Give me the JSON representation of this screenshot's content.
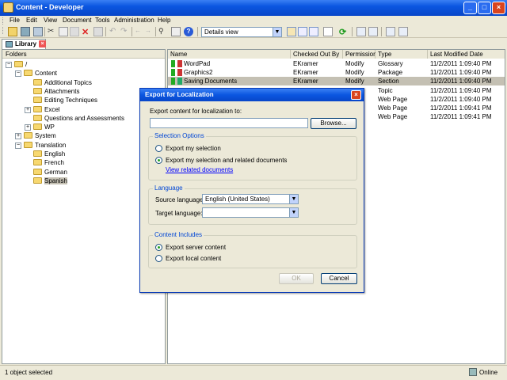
{
  "window": {
    "title": "Content - Developer"
  },
  "menu": [
    "File",
    "Edit",
    "View",
    "Document",
    "Tools",
    "Administration",
    "Help"
  ],
  "toolbar": {
    "view_selector": "Details view"
  },
  "tabs": {
    "library": "Library"
  },
  "folders": {
    "header": "Folders",
    "items": [
      {
        "label": "/",
        "depth": 0
      },
      {
        "label": "Content",
        "depth": 1
      },
      {
        "label": "Additional Topics",
        "depth": 2
      },
      {
        "label": "Attachments",
        "depth": 2
      },
      {
        "label": "Editing Techniques",
        "depth": 2
      },
      {
        "label": "Excel",
        "depth": 2
      },
      {
        "label": "Questions and Assessments",
        "depth": 2
      },
      {
        "label": "WP",
        "depth": 2
      },
      {
        "label": "System",
        "depth": 1
      },
      {
        "label": "Translation",
        "depth": 1
      },
      {
        "label": "English",
        "depth": 2
      },
      {
        "label": "French",
        "depth": 2
      },
      {
        "label": "German",
        "depth": 2
      },
      {
        "label": "Spanish",
        "depth": 2,
        "selected": true
      }
    ]
  },
  "table": {
    "columns": [
      "Name",
      "Checked Out By",
      "Permission",
      "Type",
      "Last Modified Date"
    ],
    "rows": [
      {
        "name": "WordPad",
        "checked_out_by": "EKramer",
        "permission": "Modify",
        "type": "Glossary",
        "modified": "11/2/2011 1:09:40 PM"
      },
      {
        "name": "Graphics2",
        "checked_out_by": "EKramer",
        "permission": "Modify",
        "type": "Package",
        "modified": "11/2/2011 1:09:40 PM"
      },
      {
        "name": "Saving Documents",
        "checked_out_by": "EKramer",
        "permission": "Modify",
        "type": "Section",
        "modified": "11/2/2011 1:09:40 PM",
        "selected": true
      },
      {
        "name": "",
        "checked_out_by": "",
        "permission": "",
        "type": "Topic",
        "modified": "11/2/2011 1:09:40 PM"
      },
      {
        "name": "",
        "checked_out_by": "",
        "permission": "",
        "type": "Web Page",
        "modified": "11/2/2011 1:09:40 PM"
      },
      {
        "name": "",
        "checked_out_by": "",
        "permission": "",
        "type": "Web Page",
        "modified": "11/2/2011 1:09:41 PM"
      },
      {
        "name": "",
        "checked_out_by": "",
        "permission": "",
        "type": "Web Page",
        "modified": "11/2/2011 1:09:41 PM"
      }
    ]
  },
  "status": {
    "left": "1 object selected",
    "right": "Online"
  },
  "dialog": {
    "title": "Export for Localization",
    "export_to_label": "Export content for localization to:",
    "export_to_value": "",
    "browse": "Browse...",
    "selection_options": {
      "title": "Selection Options",
      "opt1": "Export my selection",
      "opt2": "Export my selection and related documents",
      "link": "View related documents"
    },
    "language": {
      "title": "Language",
      "source_label": "Source language:",
      "source_value": "English (United States)",
      "target_label": "Target language:",
      "target_value": ""
    },
    "content_includes": {
      "title": "Content Includes",
      "opt1": "Export server content",
      "opt2": "Export local content"
    },
    "ok": "OK",
    "cancel": "Cancel"
  }
}
